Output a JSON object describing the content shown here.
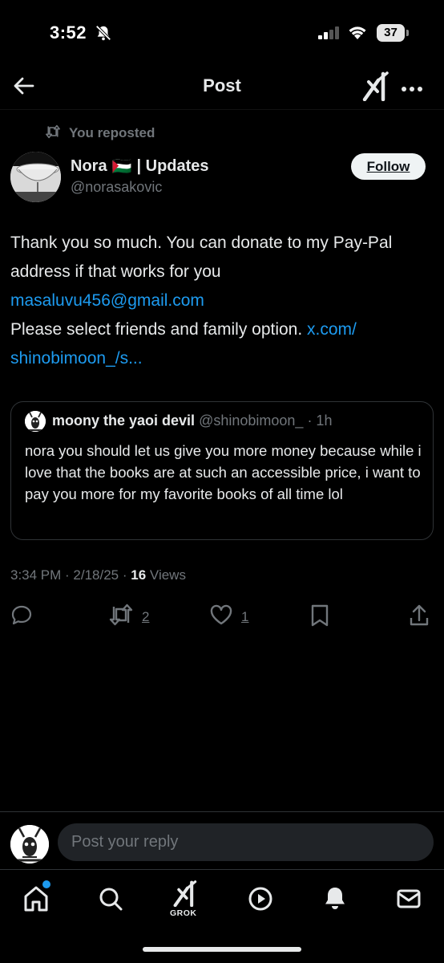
{
  "status_bar": {
    "time": "3:52",
    "battery": "37"
  },
  "header": {
    "title": "Post"
  },
  "repost": {
    "label": "You reposted"
  },
  "author": {
    "name": "Nora",
    "flag": "🇵🇸",
    "name_suffix": "| Updates",
    "handle": "@norasakovic"
  },
  "follow": {
    "label": "Follow"
  },
  "post": {
    "line1": "Thank you so much. You can donate to my Pay-Pal address if that works for you",
    "email": "masaluvu456@gmail.com",
    "line3": "Please select friends and family option.",
    "link": "x.com/ shinobimoon_/s..."
  },
  "quote": {
    "name": "moony the yaoi devil",
    "handle": "@shinobimoon_",
    "time": "· 1h",
    "text": "nora you should let us give you more money because while i love that the books are at such an accessible price, i want to pay you more for my favorite books of all time lol"
  },
  "meta": {
    "time_date": "3:34 PM · 2/18/25 · ",
    "views_count": "16",
    "views_label": "Views"
  },
  "actions": {
    "reposts": "2",
    "likes": "1"
  },
  "reply": {
    "placeholder": "Post your reply"
  },
  "tabbar": {
    "grok_label": "GROK"
  },
  "colors": {
    "accent": "#1d9bf0",
    "background": "#000000",
    "muted": "#71767b",
    "text": "#e7e9ea",
    "border": "#2f3336"
  },
  "icons": [
    "bell-off-icon",
    "signal-icon",
    "wifi-icon",
    "battery-icon",
    "back-arrow-icon",
    "grok-icon",
    "more-icon",
    "repost-icon",
    "reply-icon",
    "like-icon",
    "bookmark-icon",
    "share-icon",
    "home-icon",
    "search-icon",
    "play-icon",
    "notifications-icon",
    "messages-icon"
  ]
}
